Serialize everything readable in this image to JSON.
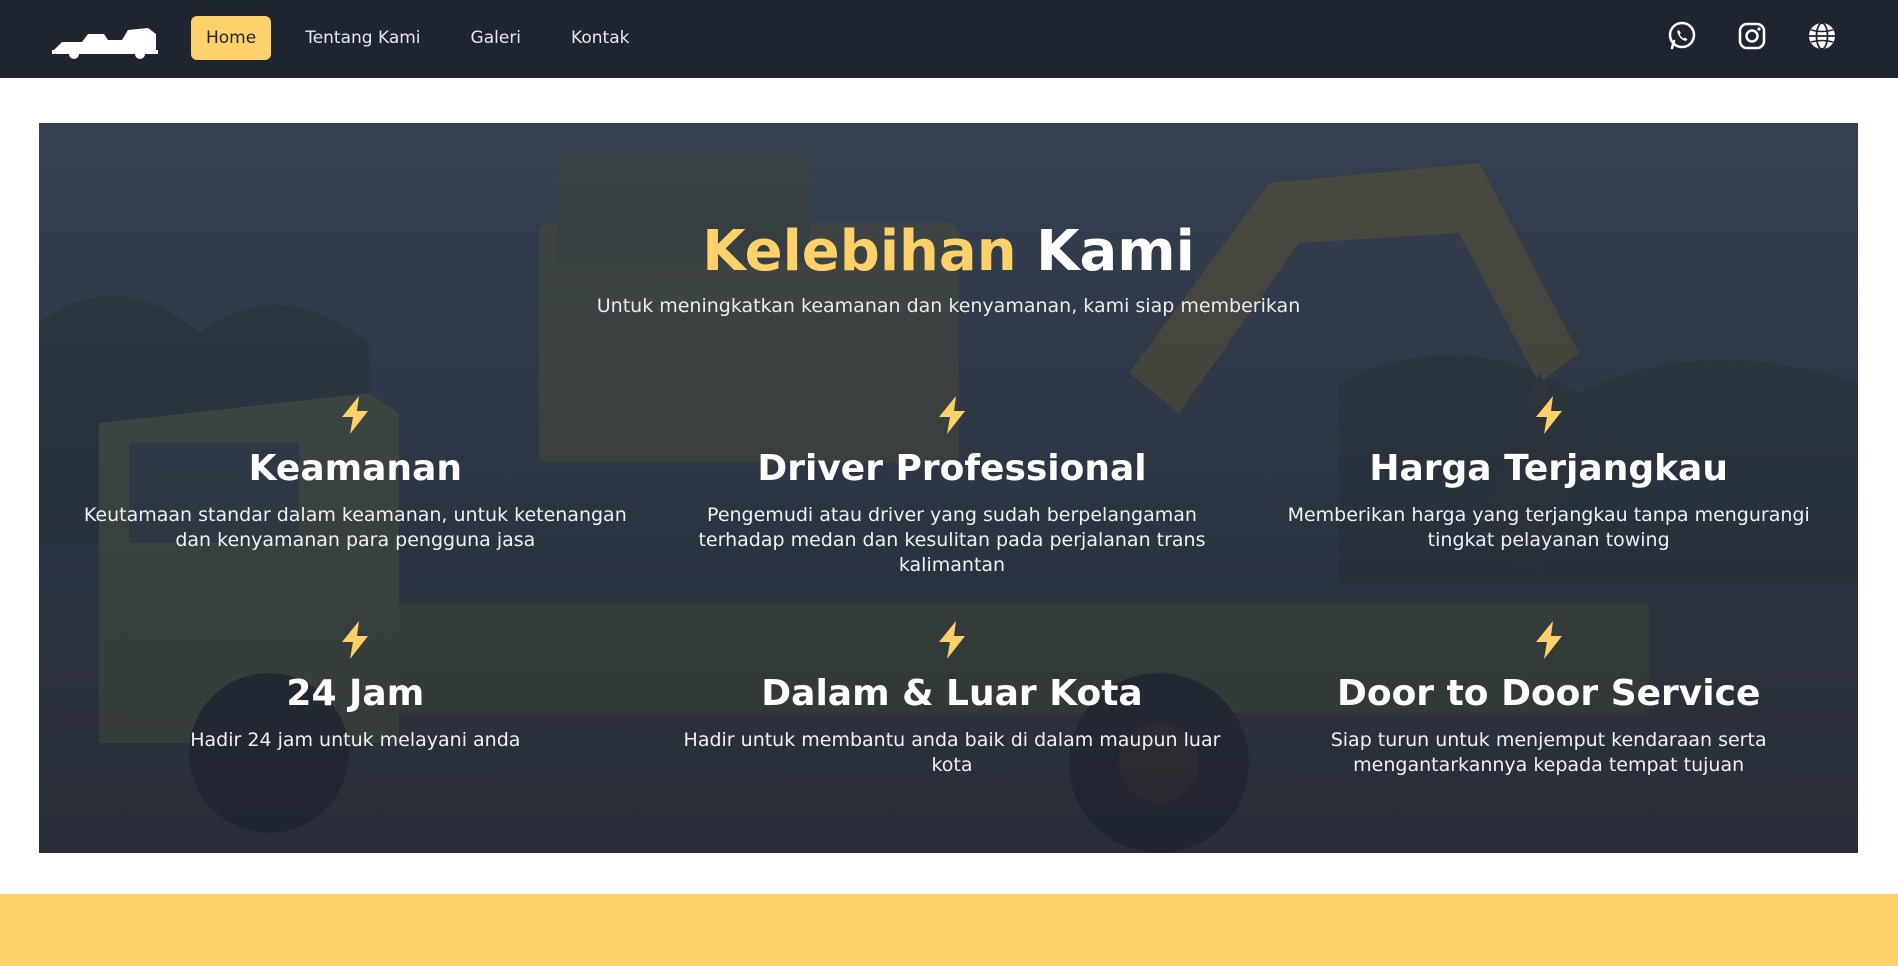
{
  "nav": {
    "links": [
      {
        "label": "Home"
      },
      {
        "label": "Tentang Kami"
      },
      {
        "label": "Galeri"
      },
      {
        "label": "Kontak"
      }
    ],
    "icons": [
      "whatsapp-icon",
      "instagram-icon",
      "globe-icon"
    ]
  },
  "hero": {
    "title_accent": "Kelebihan",
    "title_rest": "Kami",
    "subtitle": "Untuk meningkatkan keamanan dan kenyamanan, kami siap memberikan",
    "features": [
      {
        "title": "Keamanan",
        "desc": "Keutamaan standar dalam keamanan, untuk ketenangan dan kenyamanan para pengguna jasa"
      },
      {
        "title": "Driver Professional",
        "desc": "Pengemudi atau driver yang sudah berpelangaman terhadap medan dan kesulitan pada perjalanan trans kalimantan"
      },
      {
        "title": "Harga Terjangkau",
        "desc": "Memberikan harga yang terjangkau tanpa mengurangi tingkat pelayanan towing"
      },
      {
        "title": "24 Jam",
        "desc": "Hadir 24 jam untuk melayani anda"
      },
      {
        "title": "Dalam & Luar Kota",
        "desc": "Hadir untuk membantu anda baik di dalam maupun luar kota"
      },
      {
        "title": "Door to Door Service",
        "desc": "Siap turun untuk menjemput kendaraan serta mengantarkannya kepada tempat tujuan"
      }
    ]
  },
  "colors": {
    "navbar": "#1f2530",
    "accent": "#ffd16a",
    "hero_overlay": "#2a3444"
  }
}
